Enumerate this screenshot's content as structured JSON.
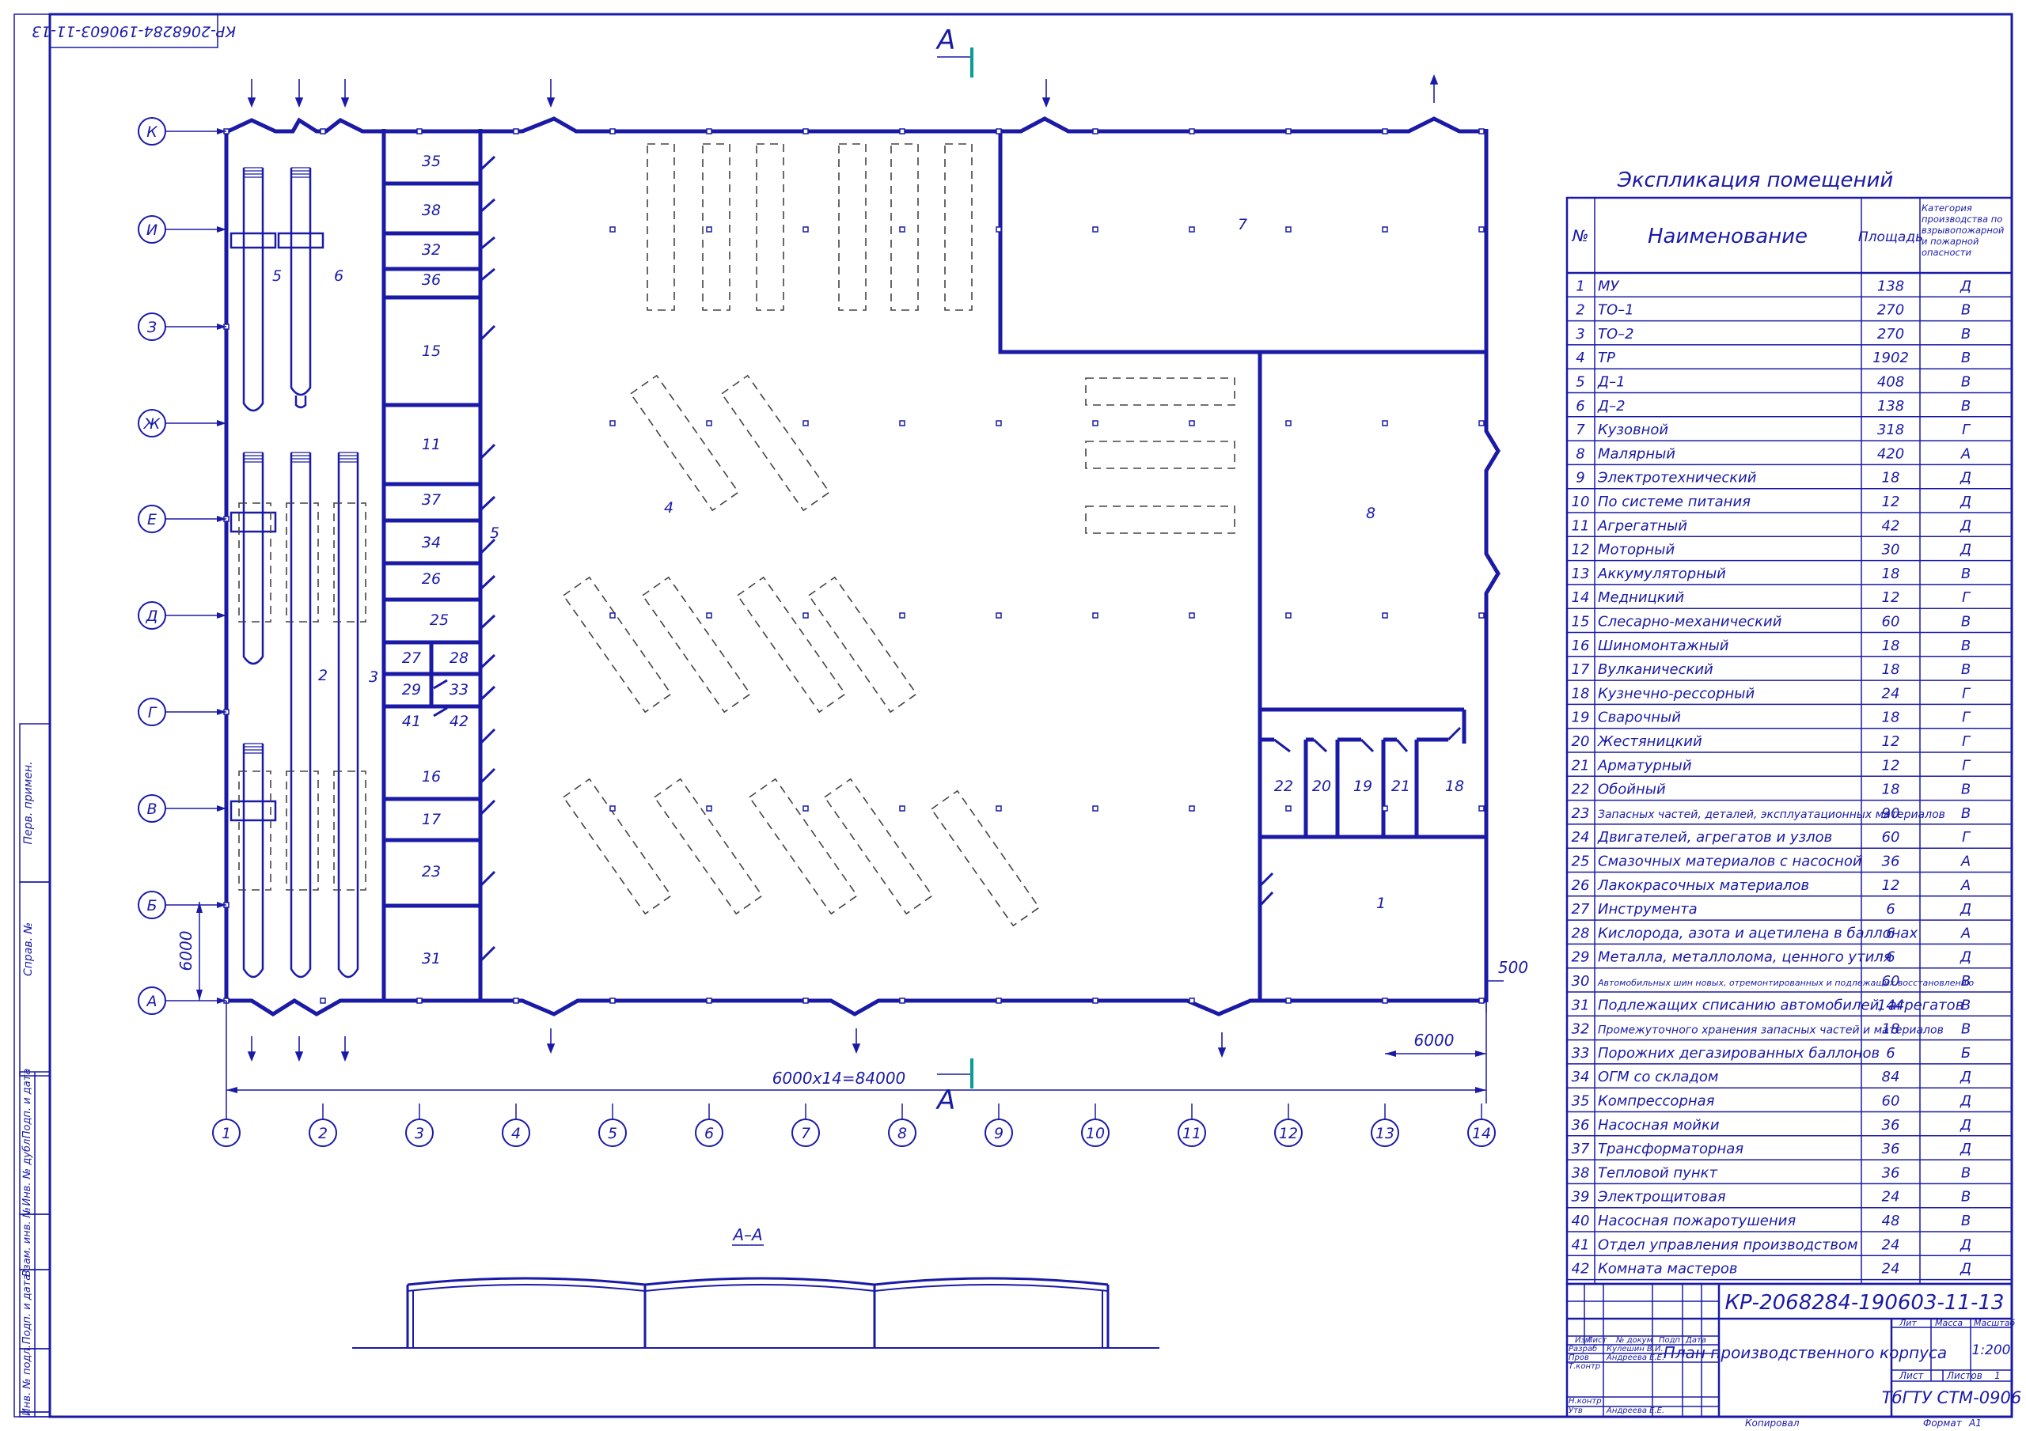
{
  "stamp_top": "КР-2068284-190603-11-13",
  "section_mark": "А",
  "row_axes": [
    "К",
    "И",
    "З",
    "Ж",
    "Е",
    "Д",
    "Г",
    "В",
    "Б",
    "А"
  ],
  "col_axes": [
    "1",
    "2",
    "3",
    "4",
    "5",
    "6",
    "7",
    "8",
    "9",
    "10",
    "11",
    "12",
    "13",
    "14"
  ],
  "dims": {
    "overall": "6000x14=84000",
    "bay": "6000",
    "right": "6000",
    "offset": "500",
    "row_step": "6000"
  },
  "room_labels": {
    "r35": "35",
    "r38": "38",
    "r32": "32",
    "r36": "36",
    "r15": "15",
    "r11": "11",
    "r37": "37",
    "r34": "34",
    "r26": "26",
    "r25": "25",
    "r27": "27",
    "r28": "28",
    "r29": "29",
    "r33": "33",
    "r41": "41",
    "r42": "42",
    "r16": "16",
    "r17": "17",
    "r23": "23",
    "r31": "31",
    "r4": "4",
    "r5a": "5",
    "r5b": "5",
    "r6": "6",
    "r2": "2",
    "r3": "3",
    "r7": "7",
    "r8": "8",
    "r1": "1",
    "r22": "22",
    "r20": "20",
    "r19": "19",
    "r21": "21",
    "r18": "18"
  },
  "section_title": "А–А",
  "explication": {
    "title": "Экспликация помещений",
    "headers": {
      "num": "№",
      "name": "Наименование",
      "area": "Площадь",
      "category": "Категория производства по взрывопожарной и пожарной опасности"
    },
    "rows": [
      {
        "n": "1",
        "name": "МУ",
        "area": "138",
        "cat": "Д"
      },
      {
        "n": "2",
        "name": "ТО–1",
        "area": "270",
        "cat": "В"
      },
      {
        "n": "3",
        "name": "ТО–2",
        "area": "270",
        "cat": "В"
      },
      {
        "n": "4",
        "name": "ТР",
        "area": "1902",
        "cat": "В"
      },
      {
        "n": "5",
        "name": "Д–1",
        "area": "408",
        "cat": "В"
      },
      {
        "n": "6",
        "name": "Д–2",
        "area": "138",
        "cat": "В"
      },
      {
        "n": "7",
        "name": "Кузовной",
        "area": "318",
        "cat": "Г"
      },
      {
        "n": "8",
        "name": "Малярный",
        "area": "420",
        "cat": "А"
      },
      {
        "n": "9",
        "name": "Электротехнический",
        "area": "18",
        "cat": "Д"
      },
      {
        "n": "10",
        "name": "По системе питания",
        "area": "12",
        "cat": "Д"
      },
      {
        "n": "11",
        "name": "Агрегатный",
        "area": "42",
        "cat": "Д"
      },
      {
        "n": "12",
        "name": "Моторный",
        "area": "30",
        "cat": "Д"
      },
      {
        "n": "13",
        "name": "Аккумуляторный",
        "area": "18",
        "cat": "В"
      },
      {
        "n": "14",
        "name": "Медницкий",
        "area": "12",
        "cat": "Г"
      },
      {
        "n": "15",
        "name": "Слесарно-механический",
        "area": "60",
        "cat": "В"
      },
      {
        "n": "16",
        "name": "Шиномонтажный",
        "area": "18",
        "cat": "В"
      },
      {
        "n": "17",
        "name": "Вулканический",
        "area": "18",
        "cat": "В"
      },
      {
        "n": "18",
        "name": "Кузнечно-рессорный",
        "area": "24",
        "cat": "Г"
      },
      {
        "n": "19",
        "name": "Сварочный",
        "area": "18",
        "cat": "Г"
      },
      {
        "n": "20",
        "name": "Жестяницкий",
        "area": "12",
        "cat": "Г"
      },
      {
        "n": "21",
        "name": "Арматурный",
        "area": "12",
        "cat": "Г"
      },
      {
        "n": "22",
        "name": "Обойный",
        "area": "18",
        "cat": "В"
      },
      {
        "n": "23",
        "name": "Запасных частей, деталей, эксплуатационных материалов",
        "area": "90",
        "cat": "В"
      },
      {
        "n": "24",
        "name": "Двигателей, агрегатов и узлов",
        "area": "60",
        "cat": "Г"
      },
      {
        "n": "25",
        "name": "Смазочных материалов с насосной",
        "area": "36",
        "cat": "А"
      },
      {
        "n": "26",
        "name": "Лакокрасочных материалов",
        "area": "12",
        "cat": "А"
      },
      {
        "n": "27",
        "name": "Инструмента",
        "area": "6",
        "cat": "Д"
      },
      {
        "n": "28",
        "name": "Кислорода, азота и ацетилена в баллонах",
        "area": "6",
        "cat": "А"
      },
      {
        "n": "29",
        "name": "Металла, металлолома, ценного утиля",
        "area": "6",
        "cat": "Д"
      },
      {
        "n": "30",
        "name": "Автомобильных шин новых, отремонтированных и подлежащих восстановлению",
        "area": "60",
        "cat": "В"
      },
      {
        "n": "31",
        "name": "Подлежащих списанию автомобилей, агрегатов",
        "area": "144",
        "cat": "В"
      },
      {
        "n": "32",
        "name": "Промежуточного хранения запасных частей и материалов",
        "area": "18",
        "cat": "В"
      },
      {
        "n": "33",
        "name": "Порожних дегазированных баллонов",
        "area": "6",
        "cat": "Б"
      },
      {
        "n": "34",
        "name": "ОГМ со складом",
        "area": "84",
        "cat": "Д"
      },
      {
        "n": "35",
        "name": "Компрессорная",
        "area": "60",
        "cat": "Д"
      },
      {
        "n": "36",
        "name": "Насосная мойки",
        "area": "36",
        "cat": "Д"
      },
      {
        "n": "37",
        "name": "Трансформаторная",
        "area": "36",
        "cat": "Д"
      },
      {
        "n": "38",
        "name": "Тепловой пункт",
        "area": "36",
        "cat": "В"
      },
      {
        "n": "39",
        "name": "Электрощитовая",
        "area": "24",
        "cat": "В"
      },
      {
        "n": "40",
        "name": "Насосная пожаротушения",
        "area": "48",
        "cat": "В"
      },
      {
        "n": "41",
        "name": "Отдел управления производством",
        "area": "24",
        "cat": "Д"
      },
      {
        "n": "42",
        "name": "Комната мастеров",
        "area": "24",
        "cat": "Д"
      }
    ]
  },
  "title_block": {
    "code": "КР-2068284-190603-11-13",
    "drawing_title": "План производственного корпуса",
    "col_izm": "Изм",
    "col_list": "Лист",
    "col_doc": "№ докум",
    "col_sign": "Подп",
    "col_date": "Дата",
    "razrab": "Разраб",
    "razrab_name": "Кулешин В.И.",
    "prov": "Пров",
    "prov_name": "Андреева Е.Е.",
    "tkontr": "Т.контр",
    "nkontr": "Н.контр",
    "utv": "Утв",
    "utv_name": "Андреева Е.Е.",
    "lit": "Лит",
    "massa": "Масса",
    "masshtab": "Масштаб",
    "scale": "1:200",
    "list_label": "Лист",
    "listov_label": "Листов",
    "listov": "1",
    "org": "ТбГТУ СТМ-0906",
    "kopiroval": "Копировал",
    "format": "Формат",
    "format_val": "А1"
  },
  "side_stamps": {
    "perv": "Перв. примен.",
    "sprav": "Справ. №",
    "podp1": "Подп. и дата",
    "inv_dubl": "Инв. № дубл.",
    "vzam": "Взам. инв. №",
    "podp2": "Подп. и дата",
    "inv_podl": "Инв. № подл."
  }
}
